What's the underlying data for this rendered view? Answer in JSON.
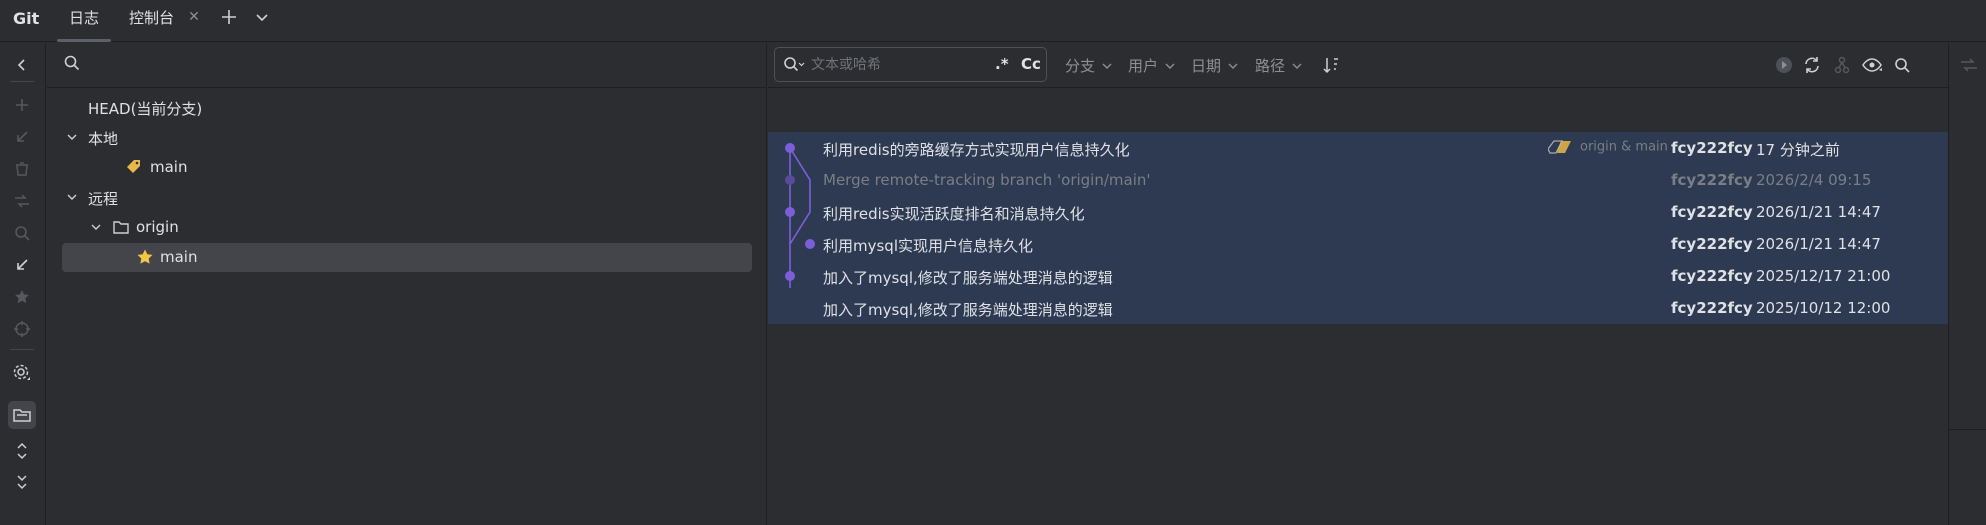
{
  "tabbar": {
    "title": "Git",
    "tabs": [
      {
        "label": "日志",
        "active": true
      },
      {
        "label": "控制台",
        "active": false
      }
    ]
  },
  "left_toolbar": {
    "icons": [
      "collapse-left-icon",
      "add-icon",
      "checkout-icon",
      "delete-icon",
      "compare-icon",
      "search-icon",
      "update-icon",
      "favorite-icon",
      "target-icon",
      "settings-icon",
      "group-by-directory-icon",
      "expand-all-icon",
      "collapse-all-icon"
    ]
  },
  "branches": {
    "search_icon": "search-icon",
    "head_label": "HEAD(当前分支)",
    "local": {
      "label": "本地",
      "branches": [
        {
          "name": "main",
          "icon": "tag-icon"
        }
      ]
    },
    "remote": {
      "label": "远程",
      "remotes": [
        {
          "name": "origin",
          "branches": [
            {
              "name": "main",
              "icon": "star-icon"
            }
          ]
        }
      ]
    }
  },
  "log": {
    "search": {
      "value": "",
      "placeholder": "文本或哈希",
      "regex_label": ".*",
      "case_label": "Cc"
    },
    "filters": [
      {
        "label": "分支"
      },
      {
        "label": "用户"
      },
      {
        "label": "日期"
      },
      {
        "label": "路径"
      }
    ],
    "toolbar_icons": [
      "sort-icon",
      "cherry-pick-icon",
      "refresh-icon",
      "branch-icon",
      "eye-icon",
      "search-icon"
    ],
    "commits": [
      {
        "subject": "利用redis的旁路缓存方式实现用户信息持久化",
        "refs": "origin & main",
        "author": "fcy222fcy",
        "date": "17 分钟之前",
        "merge": false
      },
      {
        "subject": "Merge remote-tracking branch 'origin/main'",
        "refs": "",
        "author": "fcy222fcy",
        "date": "2026/2/4 09:15",
        "merge": true
      },
      {
        "subject": "利用redis实现活跃度排名和消息持久化",
        "refs": "",
        "author": "fcy222fcy",
        "date": "2026/1/21 14:47",
        "merge": false
      },
      {
        "subject": "利用mysql实现用户信息持久化",
        "refs": "",
        "author": "fcy222fcy",
        "date": "2026/1/21 14:47",
        "merge": false
      },
      {
        "subject": "加入了mysql,修改了服务端处理消息的逻辑",
        "refs": "",
        "author": "fcy222fcy",
        "date": "2025/12/17 21:00",
        "merge": false
      },
      {
        "subject": "加入了mysql,修改了服务端处理消息的逻辑",
        "refs": "",
        "author": "fcy222fcy",
        "date": "2025/10/12 12:00",
        "merge": false
      }
    ]
  },
  "colors": {
    "background": "#2b2d30",
    "selection": "#2e3a52",
    "graph": "#7c5fd8",
    "tag": "#e8b84a",
    "star": "#f2c744"
  }
}
